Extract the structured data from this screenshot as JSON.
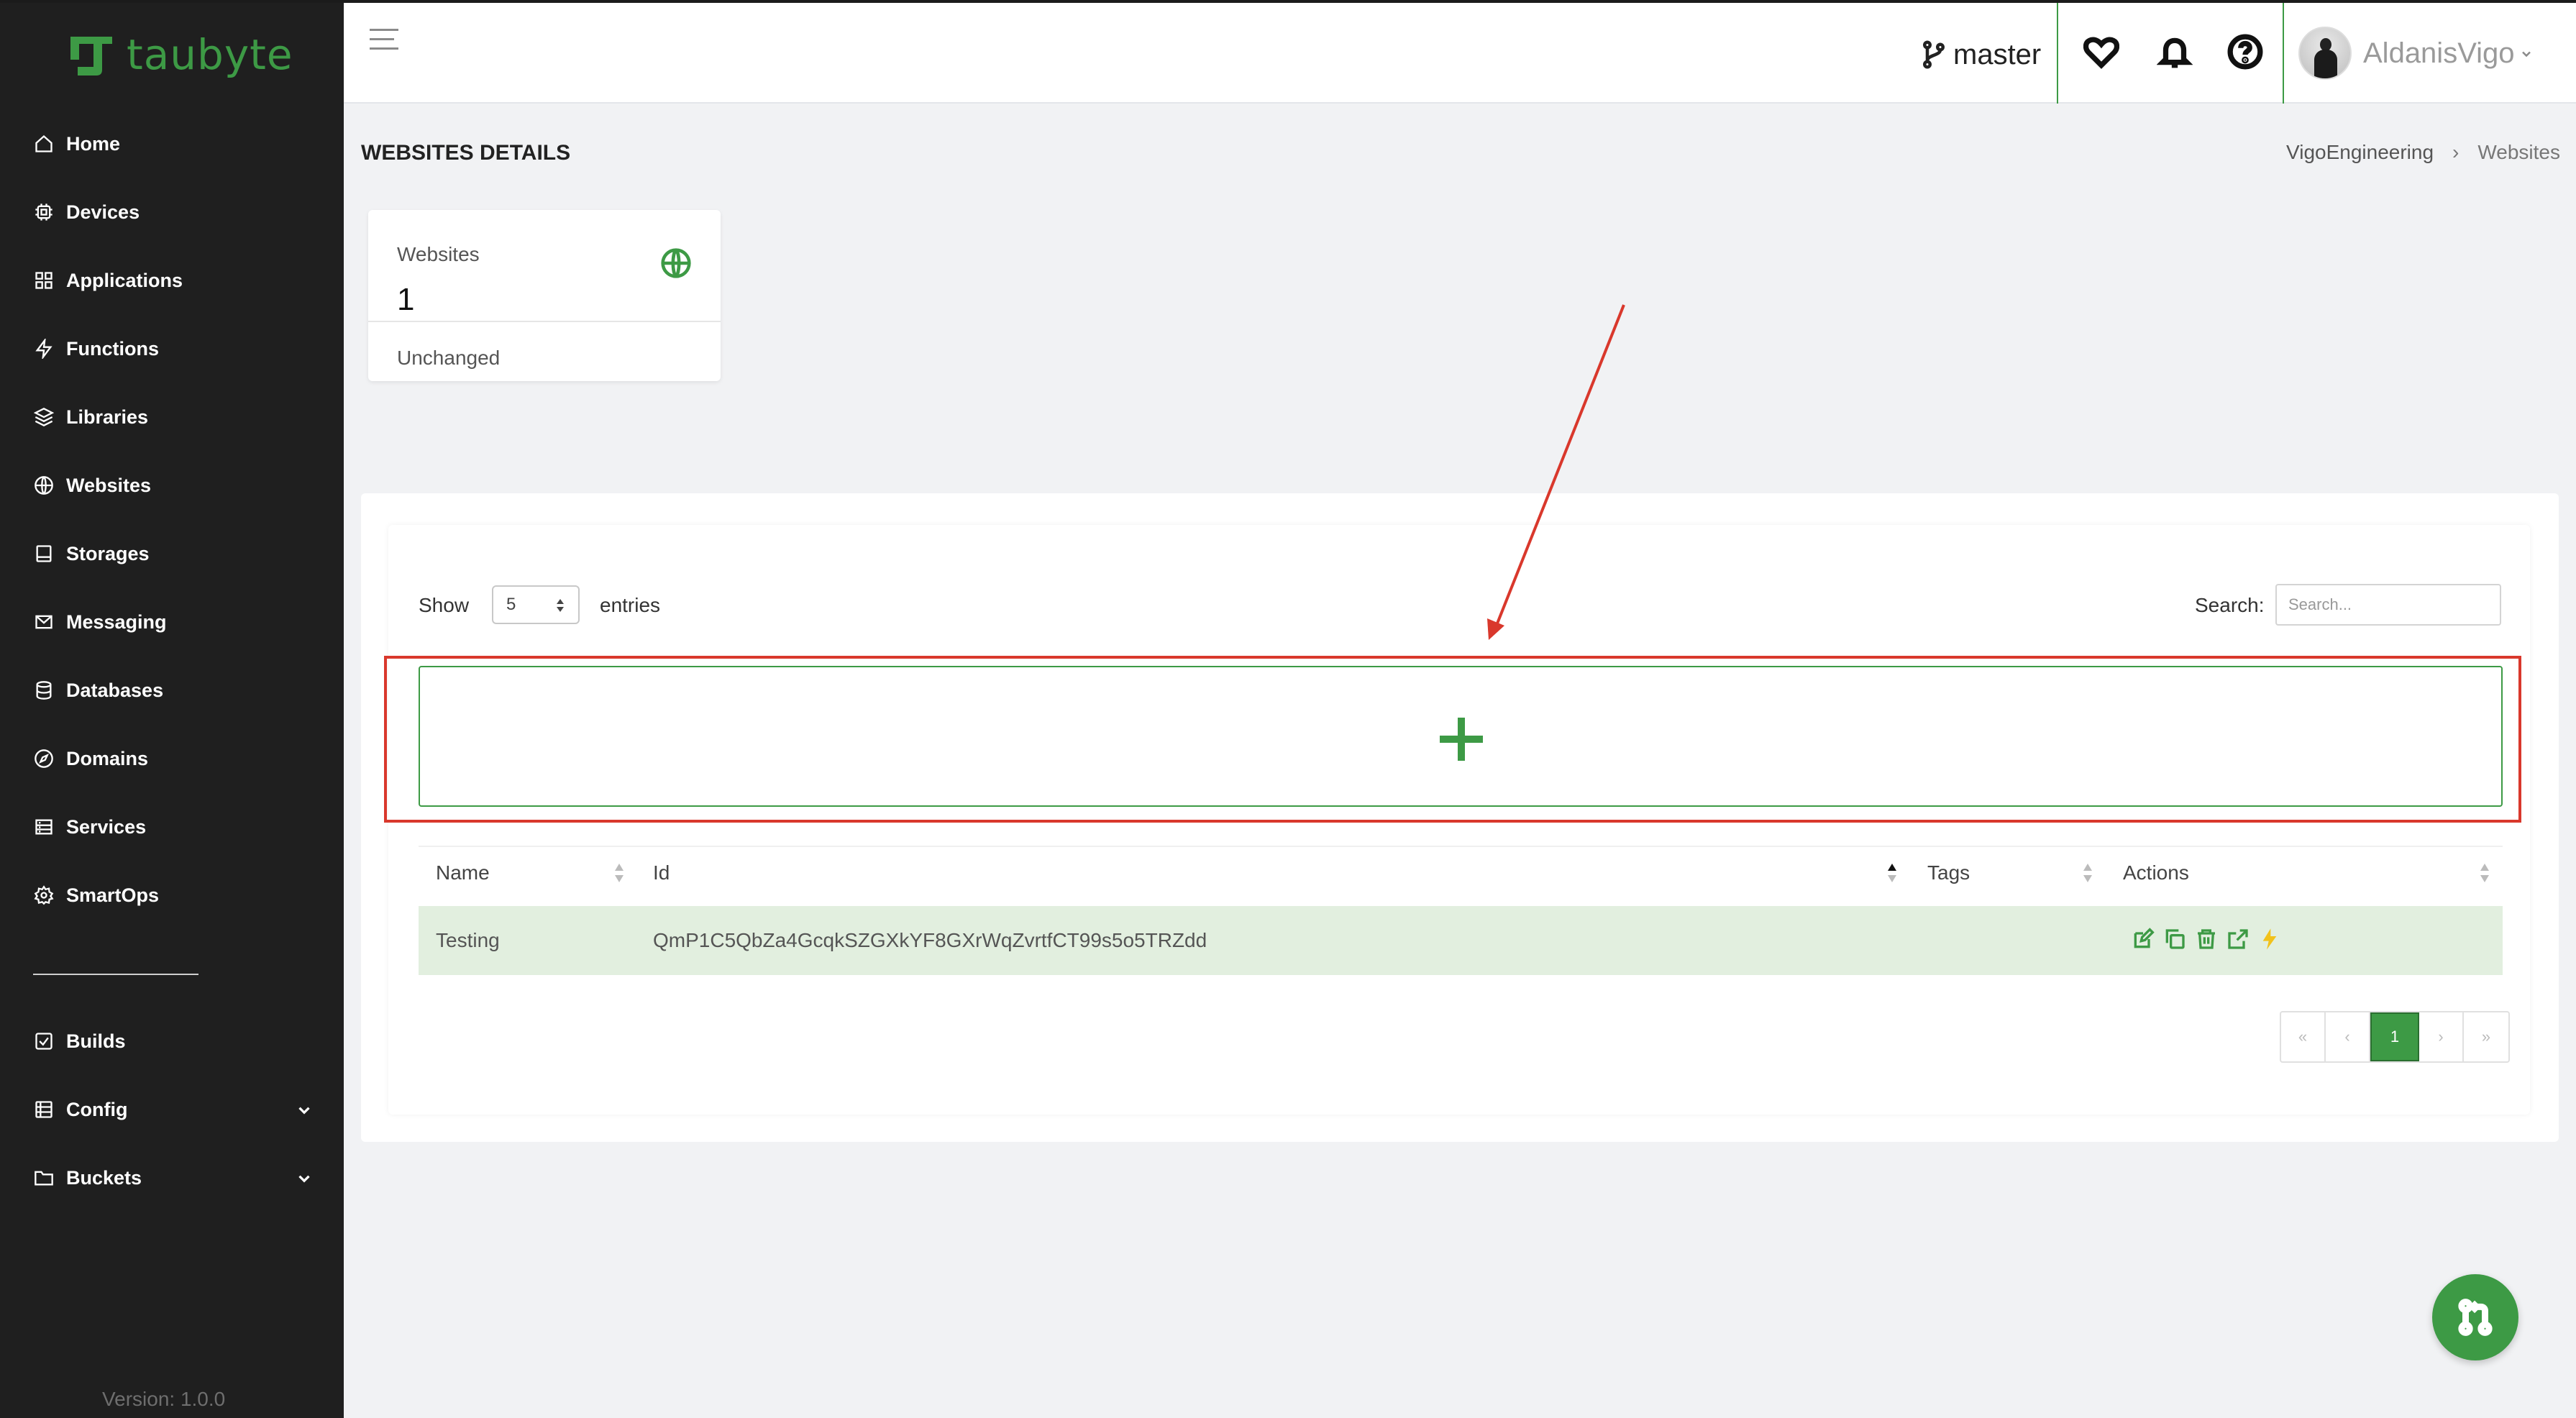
{
  "app": {
    "logo_text": "taubyte",
    "version": "Version: 1.0.0"
  },
  "sidebar": {
    "items": [
      {
        "label": "Home",
        "icon": "home-icon"
      },
      {
        "label": "Devices",
        "icon": "chip-icon"
      },
      {
        "label": "Applications",
        "icon": "grid-icon"
      },
      {
        "label": "Functions",
        "icon": "bolt-icon"
      },
      {
        "label": "Libraries",
        "icon": "layers-icon"
      },
      {
        "label": "Websites",
        "icon": "globe-icon"
      },
      {
        "label": "Storages",
        "icon": "storage-icon"
      },
      {
        "label": "Messaging",
        "icon": "mail-icon"
      },
      {
        "label": "Databases",
        "icon": "database-icon"
      },
      {
        "label": "Domains",
        "icon": "compass-icon"
      },
      {
        "label": "Services",
        "icon": "server-icon"
      },
      {
        "label": "SmartOps",
        "icon": "cog-icon"
      }
    ],
    "secondary": [
      {
        "label": "Builds",
        "icon": "check-square-icon"
      },
      {
        "label": "Config",
        "icon": "config-icon"
      },
      {
        "label": "Buckets",
        "icon": "folder-icon"
      }
    ]
  },
  "header": {
    "branch": "master",
    "user_name": "AldanisVigo"
  },
  "page": {
    "title": "WEBSITES DETAILS",
    "breadcrumb": [
      "VigoEngineering",
      "Websites"
    ]
  },
  "stat": {
    "label": "Websites",
    "value": "1",
    "footer": "Unchanged"
  },
  "table_controls": {
    "show_label": "Show",
    "show_value": "5",
    "entries_label": "entries",
    "search_label": "Search:",
    "search_placeholder": "Search..."
  },
  "table": {
    "columns": [
      "Name",
      "Id",
      "Tags",
      "Actions"
    ],
    "rows": [
      {
        "name": "Testing",
        "id": "QmP1C5QbZa4GcqkSZGXkYF8GXrWqZvrtfCT99s5o5TRZdd",
        "tags": ""
      }
    ]
  },
  "pagination": {
    "first": "«",
    "prev": "‹",
    "current": "1",
    "next": "›",
    "last": "»"
  },
  "colors": {
    "accent": "#3d9a45",
    "highlight_border": "#d9382c",
    "row_bg": "#e2efdf",
    "sidebar_bg": "#1f1f1f"
  }
}
